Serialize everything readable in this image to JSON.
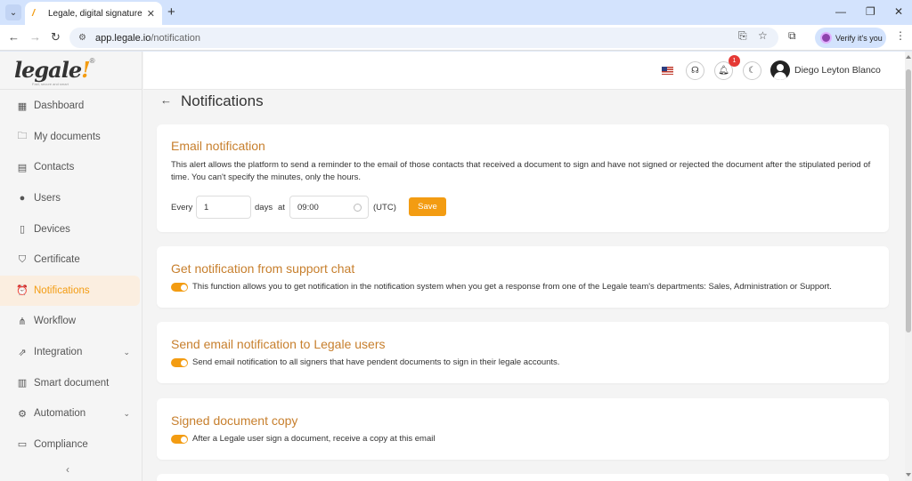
{
  "browser": {
    "tab_title": "Legale, digital signature",
    "tab_close": "✕",
    "new_tab": "+",
    "url_host": "app.legale.io",
    "url_path": "/notification",
    "verify_label": "Verify it's you"
  },
  "sidebar": {
    "logo": "legale",
    "logo_mark": "!",
    "logo_reg": "®",
    "logo_tagline": "Fast, secure and smart",
    "items": [
      {
        "label": "Dashboard",
        "icon": "dashboard-icon",
        "glyph": "▦"
      },
      {
        "label": "My documents",
        "icon": "folder-icon",
        "glyph": "🗀"
      },
      {
        "label": "Contacts",
        "icon": "contacts-icon",
        "glyph": "▤"
      },
      {
        "label": "Users",
        "icon": "user-icon",
        "glyph": "●"
      },
      {
        "label": "Devices",
        "icon": "device-icon",
        "glyph": "▯"
      },
      {
        "label": "Certificate",
        "icon": "shield-icon",
        "glyph": "⛉"
      },
      {
        "label": "Notifications",
        "icon": "alarm-icon",
        "glyph": "⏰"
      },
      {
        "label": "Workflow",
        "icon": "workflow-icon",
        "glyph": "⋔"
      },
      {
        "label": "Integration",
        "icon": "external-link-icon",
        "glyph": "⇗"
      },
      {
        "label": "Smart document",
        "icon": "smart-document-icon",
        "glyph": "▥"
      },
      {
        "label": "Automation",
        "icon": "gear-icon",
        "glyph": "⚙"
      },
      {
        "label": "Compliance",
        "icon": "chat-icon",
        "glyph": "▭"
      }
    ],
    "active_item": "Notifications",
    "collapse": "‹"
  },
  "topbar": {
    "notification_count": "1",
    "user_name": "Diego Leyton Blanco"
  },
  "page": {
    "title": "Notifications",
    "back": "←"
  },
  "cards": {
    "email": {
      "title": "Email notification",
      "description": "This alert allows the platform to send a reminder to the email of those contacts that received a document to sign and have not signed or rejected the document after the stipulated period of time. You can't specify the minutes, only the hours.",
      "every_label": "Every",
      "days_value": "1",
      "days_label": "days",
      "at_label": "at",
      "time_value": "09:00",
      "timezone": "(UTC)",
      "save_label": "Save"
    },
    "support_chat": {
      "title": "Get notification from support chat",
      "text": "This function allows you to get notification in the notification system when you get a response from one of the Legale team's departments: Sales, Administration or Support.",
      "enabled": true
    },
    "legale_users": {
      "title": "Send email notification to Legale users",
      "text": "Send email notification to all signers that have pendent documents to sign in their legale accounts.",
      "enabled": true
    },
    "signed_copy": {
      "title": "Signed document copy",
      "text": "After a Legale user sign a document, receive a copy at this email",
      "enabled": true
    }
  },
  "colors": {
    "accent": "#f39c12",
    "title": "#c77f2d",
    "badge": "#e53935"
  }
}
